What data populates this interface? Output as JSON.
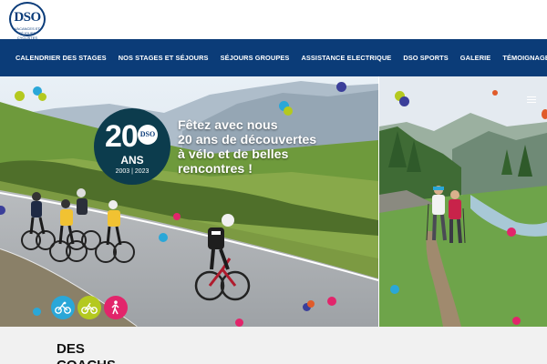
{
  "logo": {
    "name": "DSO",
    "subtitle": "VACANCES ET SÉJOURS CYCLISTES"
  },
  "nav": {
    "items": [
      {
        "label": "CALENDRIER DES STAGES"
      },
      {
        "label": "NOS STAGES ET SÉJOURS"
      },
      {
        "label": "SÉJOURS GROUPES"
      },
      {
        "label": "ASSISTANCE ELECTRIQUE"
      },
      {
        "label": "DSO SPORTS"
      },
      {
        "label": "GALERIE"
      },
      {
        "label": "TÉMOIGNAGES"
      }
    ]
  },
  "hero": {
    "badge": {
      "number": "20",
      "brand": "DSO",
      "unit": "ANS",
      "years": "2003 | 2023"
    },
    "headline_lines": [
      "Fêtez avec nous",
      "20 ans de découvertes",
      "à vélo et de belles",
      "rencontres !"
    ]
  },
  "activities": [
    {
      "icon": "cycling-icon",
      "color": "#2aa7d8"
    },
    {
      "icon": "ebike-icon",
      "color": "#b4c91f"
    },
    {
      "icon": "hiking-icon",
      "color": "#e2256b"
    }
  ],
  "section": {
    "title": "DES COACHS"
  },
  "colors": {
    "nav_bg": "#0b3c78",
    "brand": "#0b3c7a"
  }
}
